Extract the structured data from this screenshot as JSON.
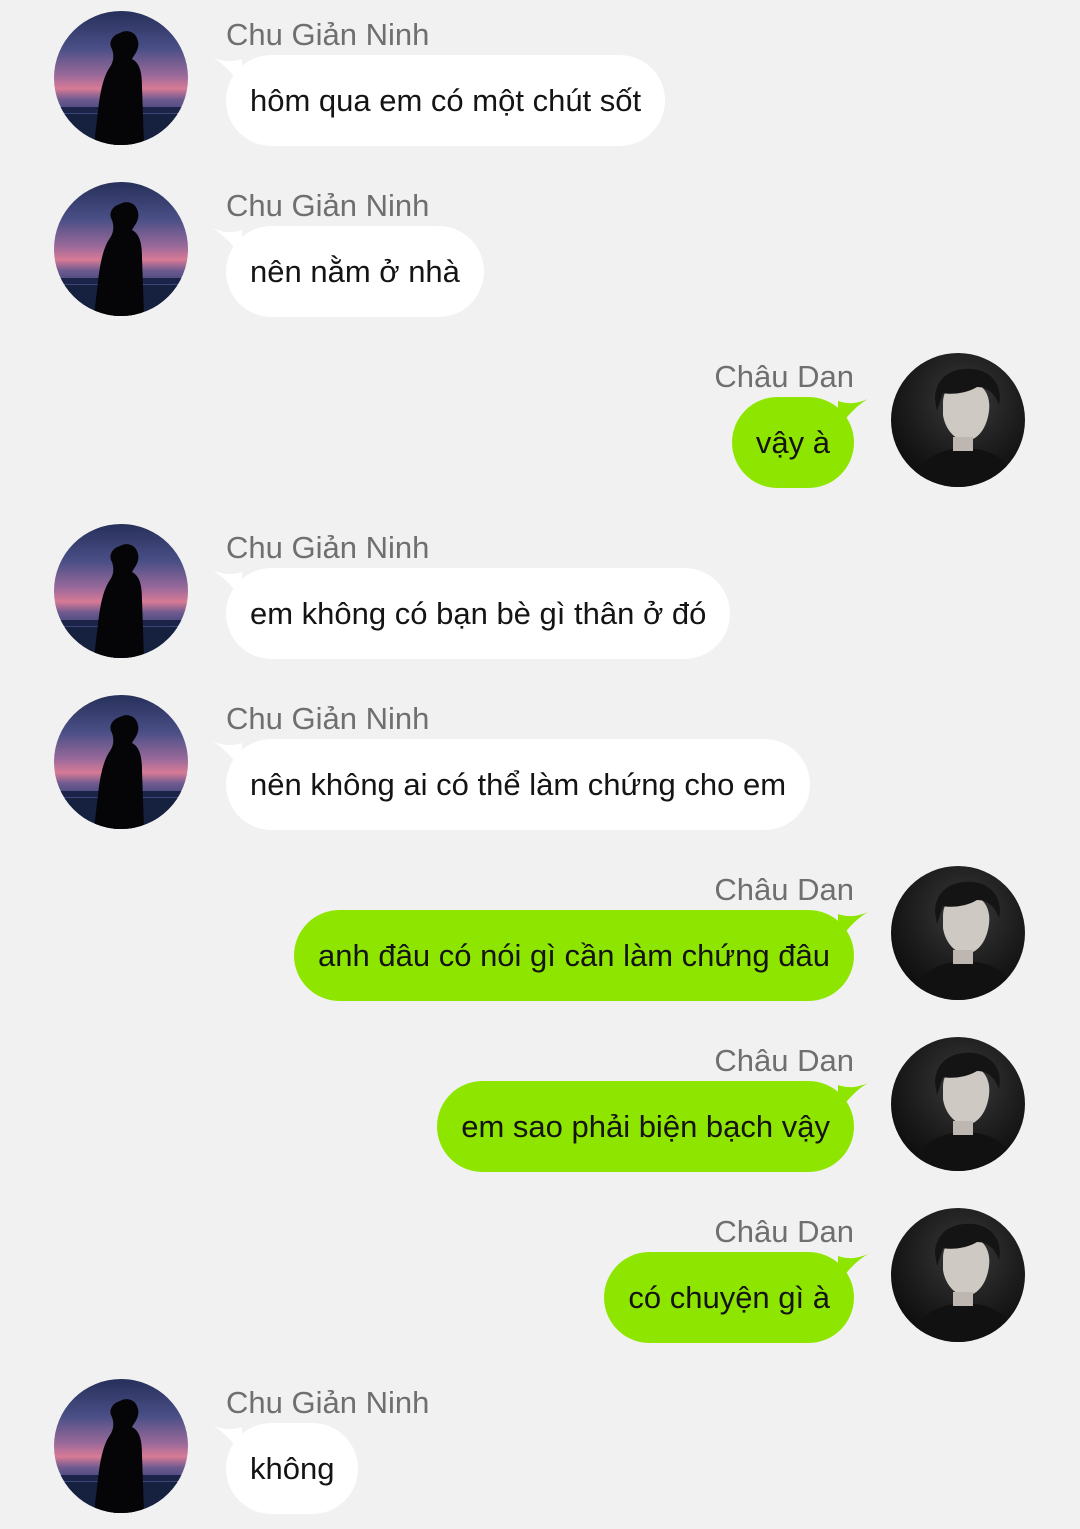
{
  "colors": {
    "background": "#f1f1f1",
    "incoming_bubble": "#ffffff",
    "outgoing_bubble": "#8ee600",
    "sender_name": "#6f6f6f",
    "message_text": "#141414"
  },
  "participants": {
    "contact": {
      "name": "Chu Giản Ninh",
      "avatar_icon": "silhouette-sunset-avatar"
    },
    "me": {
      "name": "Châu Dan",
      "avatar_icon": "profile-photo-avatar"
    }
  },
  "messages": [
    {
      "sender": "Chu Giản Ninh",
      "side": "left",
      "text": "hôm qua em có một chút sốt"
    },
    {
      "sender": "Chu Giản Ninh",
      "side": "left",
      "text": "nên nằm ở nhà"
    },
    {
      "sender": "Châu Dan",
      "side": "right",
      "text": "vậy à"
    },
    {
      "sender": "Chu Giản Ninh",
      "side": "left",
      "text": "em không có bạn bè gì thân ở đó"
    },
    {
      "sender": "Chu Giản Ninh",
      "side": "left",
      "text": "nên không ai có thể làm chứng cho em"
    },
    {
      "sender": "Châu Dan",
      "side": "right",
      "text": "anh đâu có nói gì cần làm chứng đâu"
    },
    {
      "sender": "Châu Dan",
      "side": "right",
      "text": "em sao phải biện bạch vậy"
    },
    {
      "sender": "Châu Dan",
      "side": "right",
      "text": "có chuyện gì à"
    },
    {
      "sender": "Chu Giản Ninh",
      "side": "left",
      "text": "không"
    }
  ]
}
